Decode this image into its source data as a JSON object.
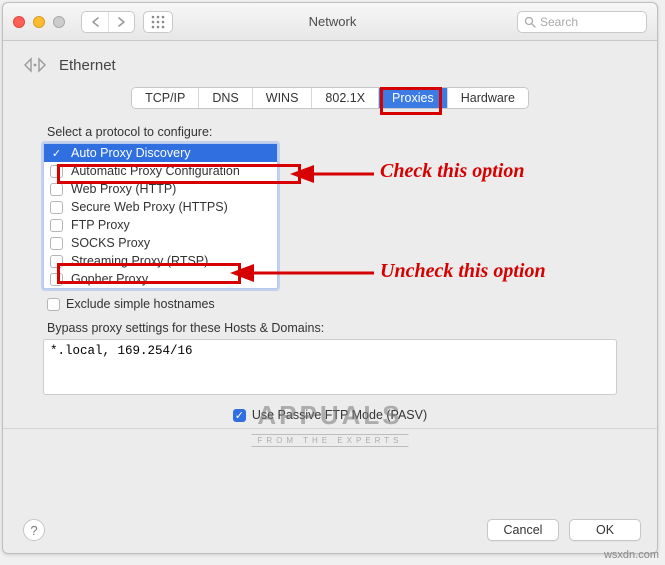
{
  "window": {
    "title": "Network",
    "search_placeholder": "Search"
  },
  "header": {
    "interface": "Ethernet"
  },
  "tabs": [
    {
      "label": "TCP/IP",
      "selected": false
    },
    {
      "label": "DNS",
      "selected": false
    },
    {
      "label": "WINS",
      "selected": false
    },
    {
      "label": "802.1X",
      "selected": false
    },
    {
      "label": "Proxies",
      "selected": true
    },
    {
      "label": "Hardware",
      "selected": false
    }
  ],
  "proxies": {
    "section_label": "Select a protocol to configure:",
    "protocols": [
      {
        "label": "Auto Proxy Discovery",
        "checked": true,
        "selected": true
      },
      {
        "label": "Automatic Proxy Configuration",
        "checked": false,
        "selected": false
      },
      {
        "label": "Web Proxy (HTTP)",
        "checked": false,
        "selected": false
      },
      {
        "label": "Secure Web Proxy (HTTPS)",
        "checked": false,
        "selected": false
      },
      {
        "label": "FTP Proxy",
        "checked": false,
        "selected": false
      },
      {
        "label": "SOCKS Proxy",
        "checked": false,
        "selected": false
      },
      {
        "label": "Streaming Proxy (RTSP)",
        "checked": false,
        "selected": false
      },
      {
        "label": "Gopher Proxy",
        "checked": false,
        "selected": false
      }
    ],
    "exclude_label": "Exclude simple hostnames",
    "exclude_checked": false,
    "bypass_label": "Bypass proxy settings for these Hosts & Domains:",
    "bypass_value": "*.local, 169.254/16",
    "pasv_label": "Use Passive FTP Mode (PASV)",
    "pasv_checked": true
  },
  "footer": {
    "cancel": "Cancel",
    "ok": "OK"
  },
  "annotations": {
    "check_text": "Check this option",
    "uncheck_text": "Uncheck this option"
  },
  "watermark": {
    "brand": "APPUALS",
    "tag": "FROM THE EXPERTS",
    "credit": "wsxdn.com"
  }
}
